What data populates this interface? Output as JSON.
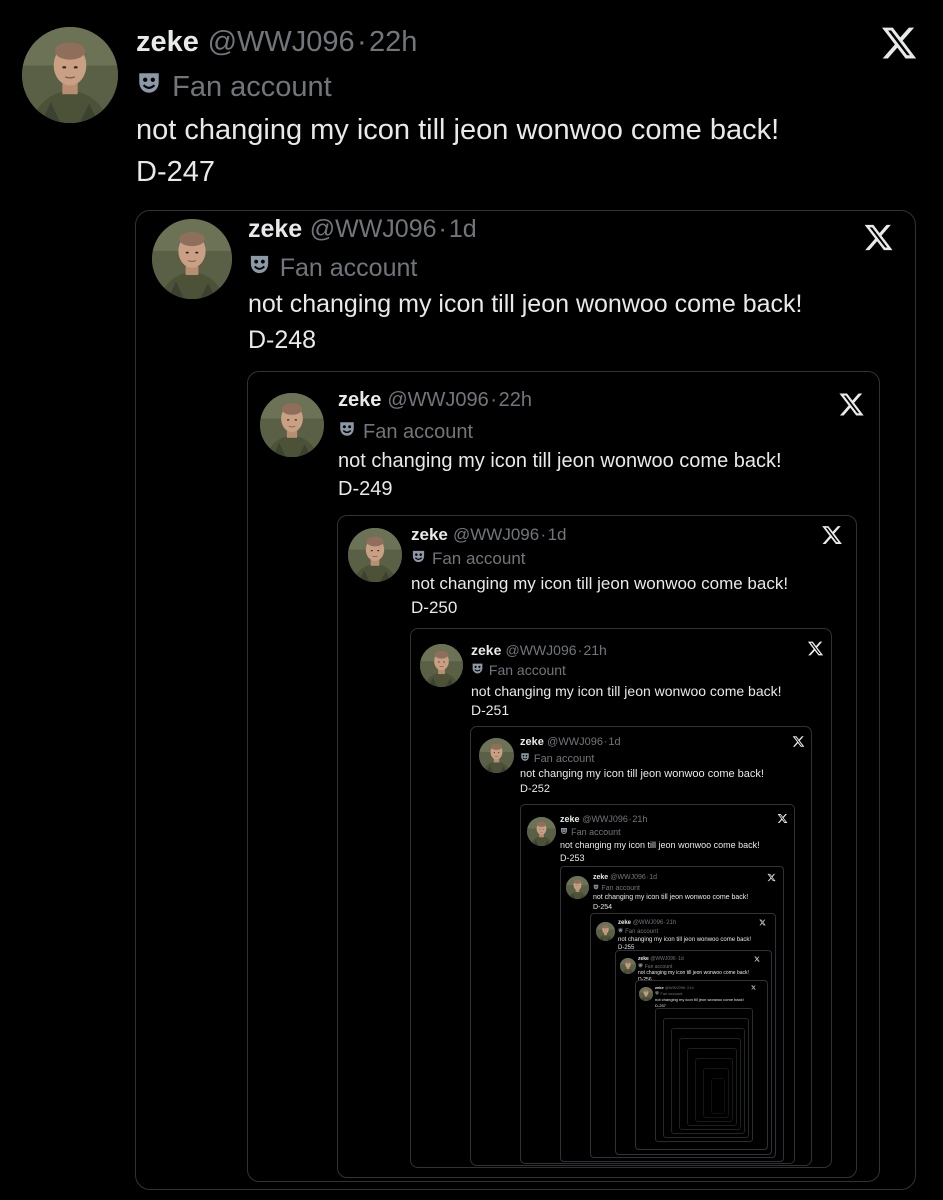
{
  "tweets": [
    {
      "name": "zeke",
      "handle": "@WWJ096",
      "separator": "·",
      "time": "22h",
      "badge": "Fan account",
      "line1": "not changing my icon till jeon wonwoo come back!",
      "line2": "D-247"
    },
    {
      "name": "zeke",
      "handle": "@WWJ096",
      "separator": "·",
      "time": "1d",
      "badge": "Fan account",
      "line1": "not changing my icon till jeon wonwoo come back!",
      "line2": "D-248"
    },
    {
      "name": "zeke",
      "handle": "@WWJ096",
      "separator": "·",
      "time": "22h",
      "badge": "Fan account",
      "line1": "not changing my icon till jeon wonwoo come back!",
      "line2": "D-249"
    },
    {
      "name": "zeke",
      "handle": "@WWJ096",
      "separator": "·",
      "time": "1d",
      "badge": "Fan account",
      "line1": "not changing my icon till jeon wonwoo come back!",
      "line2": "D-250"
    },
    {
      "name": "zeke",
      "handle": "@WWJ096",
      "separator": "·",
      "time": "21h",
      "badge": "Fan account",
      "line1": "not changing my icon till jeon wonwoo come back!",
      "line2": "D-251"
    },
    {
      "name": "zeke",
      "handle": "@WWJ096",
      "separator": "·",
      "time": "1d",
      "badge": "Fan account",
      "line1": "not changing my icon till jeon wonwoo come back!",
      "line2": "D-252"
    },
    {
      "name": "zeke",
      "handle": "@WWJ096",
      "separator": "·",
      "time": "21h",
      "badge": "Fan account",
      "line1": "not changing my icon till jeon wonwoo come back!",
      "line2": "D-253"
    },
    {
      "name": "zeke",
      "handle": "@WWJ096",
      "separator": "·",
      "time": "1d",
      "badge": "Fan account",
      "line1": "not changing my icon till jeon wonwoo come back!",
      "line2": "D-254"
    },
    {
      "name": "zeke",
      "handle": "@WWJ096",
      "separator": "·",
      "time": "21h",
      "badge": "Fan account",
      "line1": "not changing my icon till jeon wonwoo come back!",
      "line2": "D-255"
    },
    {
      "name": "zeke",
      "handle": "@WWJ096",
      "separator": "·",
      "time": "1d",
      "badge": "Fan account",
      "line1": "not changing my icon till jeon wonwoo come back!",
      "line2": "D-256"
    },
    {
      "name": "zeke",
      "handle": "@WWJ096",
      "separator": "·",
      "time": "21h",
      "badge": "Fan account",
      "line1": "not changing my icon till jeon wonwoo come back!",
      "line2": "D-257"
    }
  ],
  "icons": {
    "logo": "x-logo-icon",
    "badge": "theater-mask-icon",
    "avatar": "profile-avatar"
  },
  "colors": {
    "background": "#000000",
    "text": "#e7e9ea",
    "secondary": "#71767b",
    "border": "#2f3336"
  }
}
